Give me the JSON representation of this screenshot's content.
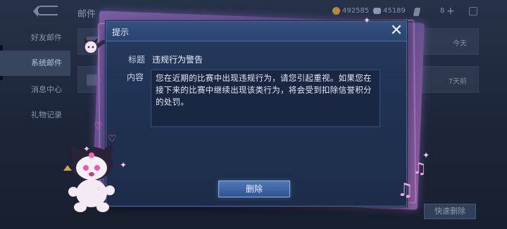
{
  "background": {
    "page_title": "邮件",
    "gold_count": "492585",
    "gem_count": "45189",
    "slot_count": "8",
    "plus_symbol": "+",
    "sidebar": {
      "items": [
        {
          "label": "好友邮件"
        },
        {
          "label": "系统邮件"
        },
        {
          "label": "消息中心"
        },
        {
          "label": "礼物记录"
        }
      ]
    },
    "mail_rows": [
      {
        "time": "今天"
      },
      {
        "time": "7天前"
      }
    ],
    "quick_delete_label": "快速删除"
  },
  "dialog": {
    "title": "提示",
    "close_symbol": "✕",
    "subject_label": "标题",
    "subject_value": "违规行为警告",
    "content_label": "内容",
    "content_value": "您在近期的比赛中出现违规行为，请您引起重视。如果您在接下来的比赛中继续出现该类行为，将会受到扣除信誉积分的处罚。",
    "delete_label": "删除"
  },
  "icons": {
    "coin": "gold-coin-icon",
    "gem": "gem-icon",
    "ticket": "ticket-icon",
    "back": "back-arrow-icon",
    "close": "close-icon",
    "mascot": "kuromi-mascot",
    "heart": "heart-icon",
    "note": "music-note-icon"
  },
  "colors": {
    "dialog_bg": "#1f3050",
    "backing_purple": "#7a5ea6",
    "button_blue": "#3f66a2",
    "heart_pink": "#f37cc0"
  }
}
